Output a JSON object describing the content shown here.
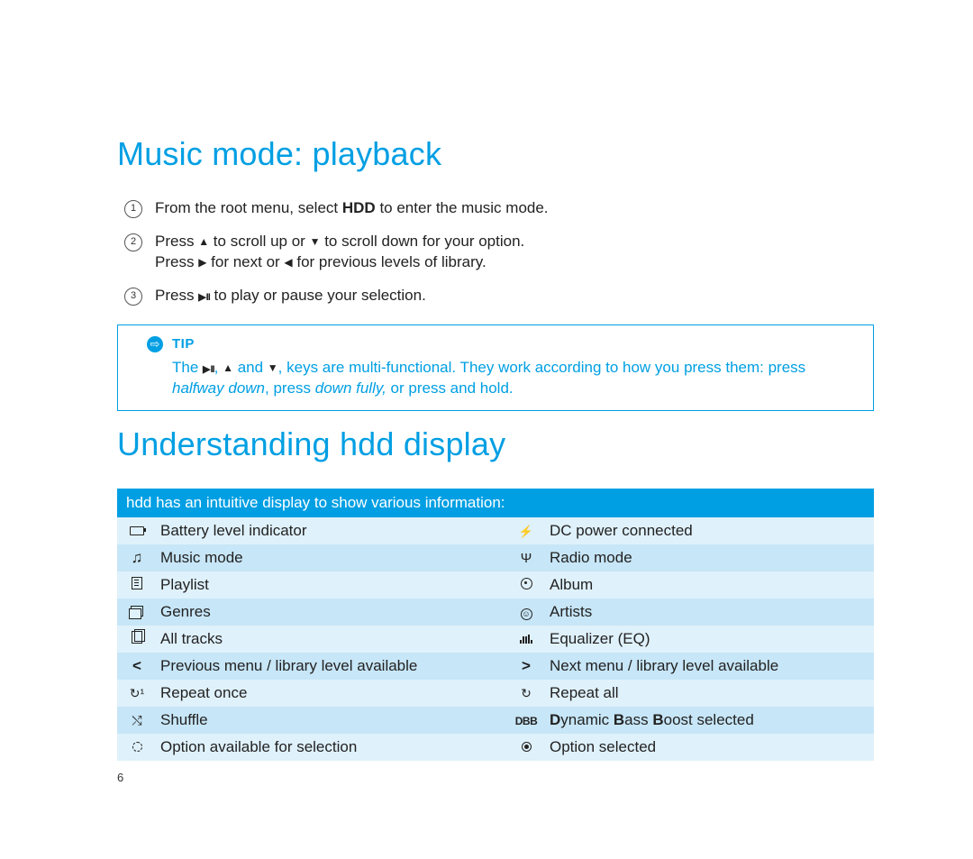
{
  "section1": {
    "title": "Music mode: playback",
    "steps": [
      {
        "num": "1",
        "pre": "From the root menu, select ",
        "bold": "HDD",
        "post": " to enter the music mode."
      },
      {
        "num": "2",
        "line1_a": "Press ",
        "line1_b": " to scroll up or ",
        "line1_c": " to scroll down for your option.",
        "line2_a": "Press ",
        "line2_b": " for next or ",
        "line2_c": " for previous levels of library."
      },
      {
        "num": "3",
        "a": "Press ",
        "b": " to play or pause your selection."
      }
    ],
    "tip": {
      "label": "TIP",
      "body_a": "The ",
      "body_b": ", ",
      "body_c": " and ",
      "body_d": ", keys are multi-functional. They work according to how you press them:  press ",
      "italic1": "halfway down",
      "body_e": ", press ",
      "italic2": "down fully,",
      "body_f": " or press and hold."
    }
  },
  "section2": {
    "title": "Understanding hdd display",
    "header": "hdd has an intuitive display to show various information:",
    "rows": [
      {
        "l": "Battery level indicator",
        "r": "DC power connected"
      },
      {
        "l": "Music mode",
        "r": "Radio mode"
      },
      {
        "l": "Playlist",
        "r": "Album"
      },
      {
        "l": "Genres",
        "r": "Artists"
      },
      {
        "l": "All tracks",
        "r": "Equalizer (EQ)"
      },
      {
        "l": "Previous menu / library level available",
        "r": "Next menu / library level available"
      },
      {
        "l": "Repeat once",
        "r": "Repeat all"
      },
      {
        "l": "Shuffle",
        "r_pre": "D",
        "r_mid1": "ynamic ",
        "r_b2": "B",
        "r_mid2": "ass ",
        "r_b3": "B",
        "r_post": "oost selected"
      },
      {
        "l": "Option available for selection",
        "r": "Option selected"
      }
    ]
  },
  "page_number": "6"
}
